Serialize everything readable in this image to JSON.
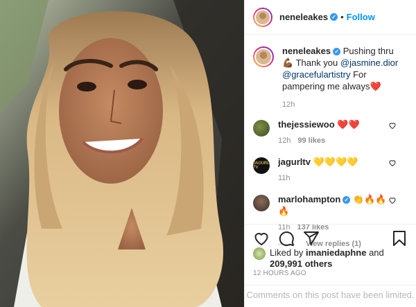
{
  "post": {
    "author": "neneleakes",
    "follow_label": "Follow",
    "dot": "•",
    "verified_glyph": "✓",
    "caption": {
      "username": "neneleakes",
      "text_before": " Pushing thru💪🏾 Thank you ",
      "mention1": "@jasmine.dior",
      "space": " ",
      "mention2": "@gracefulartistry",
      "text_after": " For pampering me always❤️",
      "time": "12h"
    },
    "comments": [
      {
        "username": "thejessiewoo",
        "text": "❤️❤️",
        "time": "12h",
        "likes": "99 likes",
        "avatar_icon": "user-avatar-icon"
      },
      {
        "username": "jagurltv",
        "text": "💛💛💛💛",
        "time": "11h",
        "likes": "",
        "avatar_icon": "brand-logo-avatar-icon",
        "avatar_text": "JAGURL TV"
      },
      {
        "username": "marlohampton",
        "text": "👏🔥🔥🔥",
        "time": "11h",
        "likes": "137 likes",
        "avatar_icon": "user-avatar-icon"
      }
    ],
    "view_replies": "View replies (1)",
    "liked_by_prefix": "Liked by ",
    "liked_by_user": "imaniedaphne",
    "liked_by_and": " and",
    "liked_count": "209,991 others",
    "timestamp": "12 HOURS AGO",
    "comments_limited": "Comments on this post have been limited."
  },
  "colors": {
    "link": "#0095f6",
    "verified": "#3897f0",
    "muted": "#8e8e8e",
    "text": "#262626"
  },
  "icons": [
    "heart-icon",
    "comment-icon",
    "share-icon",
    "bookmark-icon",
    "verified-badge-icon",
    "small-heart-icon"
  ]
}
